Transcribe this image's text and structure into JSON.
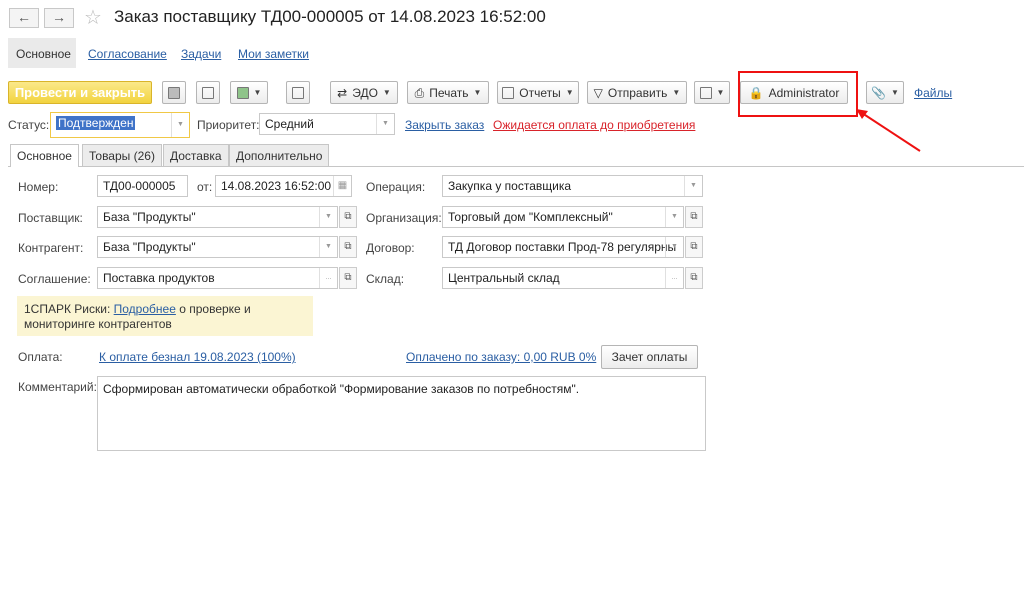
{
  "window": {
    "title": "Заказ поставщику ТД00-000005 от 14.08.2023 16:52:00"
  },
  "nav_tabs": [
    "Основное",
    "Согласование",
    "Задачи",
    "Мои заметки"
  ],
  "toolbar": {
    "post_close": "Провести и закрыть",
    "edo": "ЭДО",
    "print": "Печать",
    "reports": "Отчеты",
    "send": "Отправить",
    "user": "Administrator",
    "files": "Файлы"
  },
  "status_row": {
    "status_label": "Статус:",
    "status_value": "Подтвержден",
    "priority_label": "Приоритет:",
    "priority_value": "Средний",
    "close_order": "Закрыть заказ",
    "awaiting_payment": "Ожидается оплата до приобретения"
  },
  "form_tabs": [
    "Основное",
    "Товары (26)",
    "Доставка",
    "Дополнительно"
  ],
  "fields": {
    "number_label": "Номер:",
    "number_value": "ТД00-000005",
    "from_label": "от:",
    "date_value": "14.08.2023 16:52:00",
    "operation_label": "Операция:",
    "operation_value": "Закупка у поставщика",
    "supplier_label": "Поставщик:",
    "supplier_value": "База \"Продукты\"",
    "organization_label": "Организация:",
    "organization_value": "Торговый дом \"Комплексный\"",
    "counterparty_label": "Контрагент:",
    "counterparty_value": "База \"Продукты\"",
    "contract_label": "Договор:",
    "contract_value": "ТД Договор поставки Прод-78 регулярны",
    "agreement_label": "Соглашение:",
    "agreement_value": "Поставка продуктов",
    "warehouse_label": "Склад:",
    "warehouse_value": "Центральный склад"
  },
  "spark": {
    "prefix": "1СПАРК Риски:",
    "link": "Подробнее",
    "text1": "о проверке и",
    "text2": "мониторинге контрагентов"
  },
  "payment": {
    "label": "Оплата:",
    "link": "К оплате безнал 19.08.2023 (100%)",
    "paid": "Оплачено по заказу: 0,00 RUB 0%",
    "offset_button": "Зачет оплаты"
  },
  "comment": {
    "label": "Комментарий:",
    "value": "Сформирован автоматически обработкой \"Формирование заказов по потребностям\"."
  },
  "colors": {
    "accent": "#f2d33f",
    "link": "#2a5ea3",
    "alert": "#d8232a",
    "highlight_box": "#ee1111"
  }
}
